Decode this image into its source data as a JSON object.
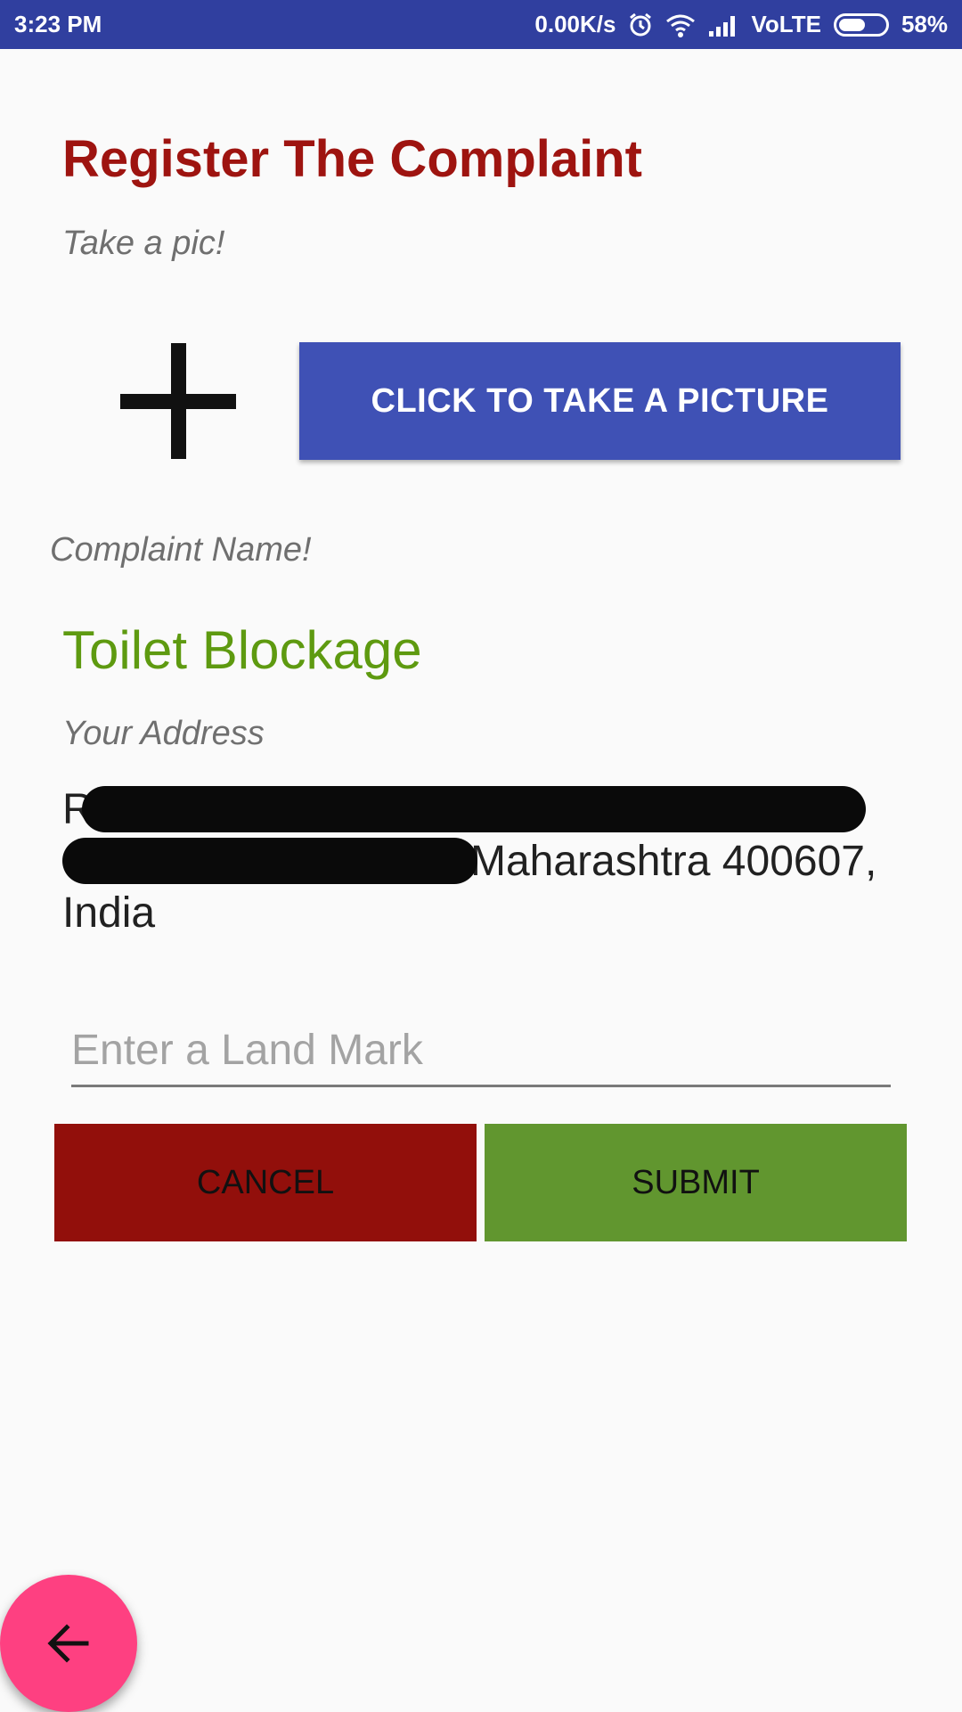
{
  "status_bar": {
    "time": "3:23 PM",
    "network_speed": "0.00K/s",
    "network_type": "VoLTE",
    "battery_percent": "58%",
    "battery_level": 0.58,
    "icons": [
      "alarm-icon",
      "wifi-icon",
      "signal-icon",
      "battery-icon"
    ]
  },
  "page": {
    "title": "Register The Complaint",
    "take_pic_caption": "Take a pic!",
    "add_photo_icon": "plus-icon",
    "take_picture_button": "CLICK TO TAKE A PICTURE",
    "complaint_name_caption": "Complaint Name!",
    "complaint_name": "Toilet Blockage",
    "address_caption": "Your Address",
    "address_lines": [
      "R",
      "Maharashtra 400607,",
      "India"
    ],
    "landmark_placeholder": "Enter a Land Mark",
    "landmark_value": "",
    "cancel_button": "CANCEL",
    "submit_button": "SUBMIT",
    "back_icon": "arrow-left-icon"
  },
  "colors": {
    "status_bar": "#303f9f",
    "title": "#9e1410",
    "primary_button": "#3f51b5",
    "complaint_name": "#5e9a10",
    "cancel": "#920f0b",
    "submit": "#61962f",
    "fab": "#fe4081"
  }
}
